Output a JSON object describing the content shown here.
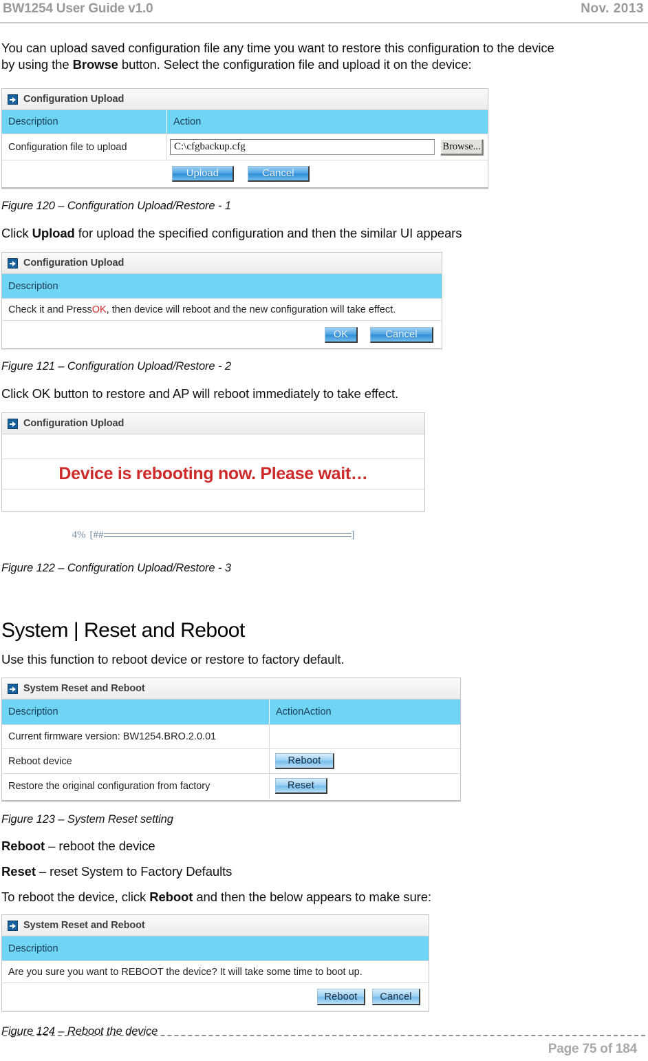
{
  "header": {
    "title": "BW1254 User Guide v1.0",
    "date": "Nov.  2013"
  },
  "paragraphs": {
    "intro_1": "You can upload saved configuration file any time you want to restore this configuration to the device",
    "intro_2_pre": "by using the ",
    "intro_2_bold": "Browse",
    "intro_2_post": " button. Select the configuration file and upload it on the device:",
    "click_upload_pre": "Click ",
    "click_upload_bold": "Upload",
    "click_upload_post": " for upload the specified configuration and then the similar UI appears",
    "click_ok": "Click OK button to restore and AP will reboot immediately to take effect.",
    "use_function": "Use this function to reboot device or restore to factory default.",
    "reboot_def_bold": "Reboot",
    "reboot_def_rest": " – reboot the device",
    "reset_def_bold": "Reset",
    "reset_def_rest": " – reset System to Factory Defaults",
    "to_reboot_pre": "To reboot the device, click ",
    "to_reboot_bold": "Reboot",
    "to_reboot_post": " and then the below appears to make sure:"
  },
  "section_heading": "System | Reset and Reboot",
  "captions": {
    "fig120": "Figure 120 – Configuration Upload/Restore - 1",
    "fig121": "Figure 121 – Configuration Upload/Restore - 2",
    "fig122": "Figure 122 – Configuration Upload/Restore - 3",
    "fig123": "Figure 123 – System Reset setting",
    "fig124": "Figure 124 – Reboot the device"
  },
  "figure120": {
    "panel_title": "Configuration Upload",
    "columns": [
      "Description",
      "Action"
    ],
    "row_label": "Configuration file to upload",
    "file_value": "C:\\cfgbackup.cfg",
    "browse_label": "Browse...",
    "upload_label": "Upload",
    "cancel_label": "Cancel"
  },
  "figure121": {
    "panel_title": "Configuration Upload",
    "columns": [
      "Description"
    ],
    "message_pre": "Check it and Press ",
    "message_red": "OK",
    "message_post": ", then device will reboot and the new configuration will take effect.",
    "ok_label": "OK",
    "cancel_label": "Cancel"
  },
  "figure122": {
    "panel_title": "Configuration Upload",
    "reboot_message": "Device is rebooting now. Please wait…",
    "progress_percent": "4%",
    "progress_bar_open": "[##",
    "progress_bar_close": "]"
  },
  "figure123": {
    "panel_title": "System Reset and Reboot",
    "columns": [
      "Description",
      "ActionAction"
    ],
    "rows": [
      {
        "label": "Current firmware version: BW1254.BRO.2.0.01",
        "button": ""
      },
      {
        "label": "Reboot device",
        "button": "Reboot"
      },
      {
        "label": "Restore the original configuration from factory",
        "button": "Reset"
      }
    ]
  },
  "figure124": {
    "panel_title": "System Reset and Reboot",
    "columns": [
      "Description"
    ],
    "message": "Are you sure you want to REBOOT the device? It will take some time to boot up.",
    "reboot_label": "Reboot",
    "cancel_label": "Cancel"
  },
  "footer": {
    "page_label": "Page 75 of 184"
  },
  "colors": {
    "header_blue": "#6fd5f5",
    "accent_red": "#cf2a2a",
    "muted_gray": "#9a9a9a"
  }
}
